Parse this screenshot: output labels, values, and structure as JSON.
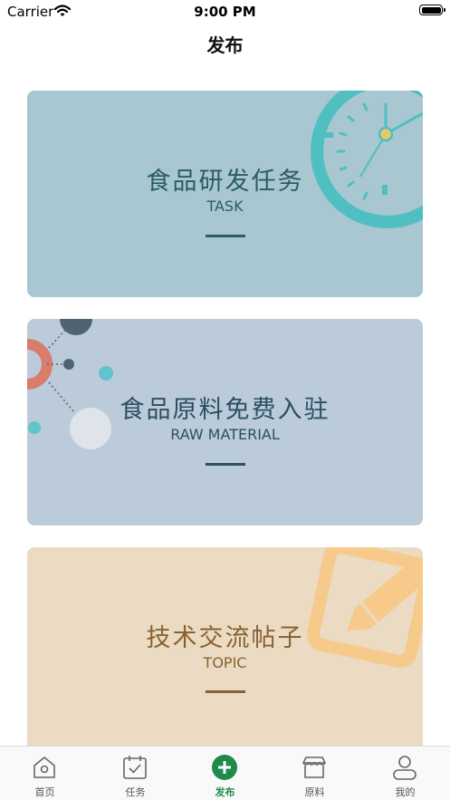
{
  "status_bar": {
    "carrier": "Carrier",
    "time": "9:00 PM"
  },
  "nav": {
    "title": "发布"
  },
  "cards": [
    {
      "title": "食品研发任务",
      "subtitle": "TASK"
    },
    {
      "title": "食品原料免费入驻",
      "subtitle": "RAW MATERIAL"
    },
    {
      "title": "技术交流帖子",
      "subtitle": "TOPIC"
    }
  ],
  "tab_bar": {
    "active_index": 2,
    "active_color": "#1f8a4c",
    "items": [
      {
        "label": "首页",
        "icon": "home-icon"
      },
      {
        "label": "任务",
        "icon": "clipboard-check-icon"
      },
      {
        "label": "发布",
        "icon": "plus-circle-icon"
      },
      {
        "label": "原料",
        "icon": "store-icon"
      },
      {
        "label": "我的",
        "icon": "user-icon"
      }
    ]
  }
}
